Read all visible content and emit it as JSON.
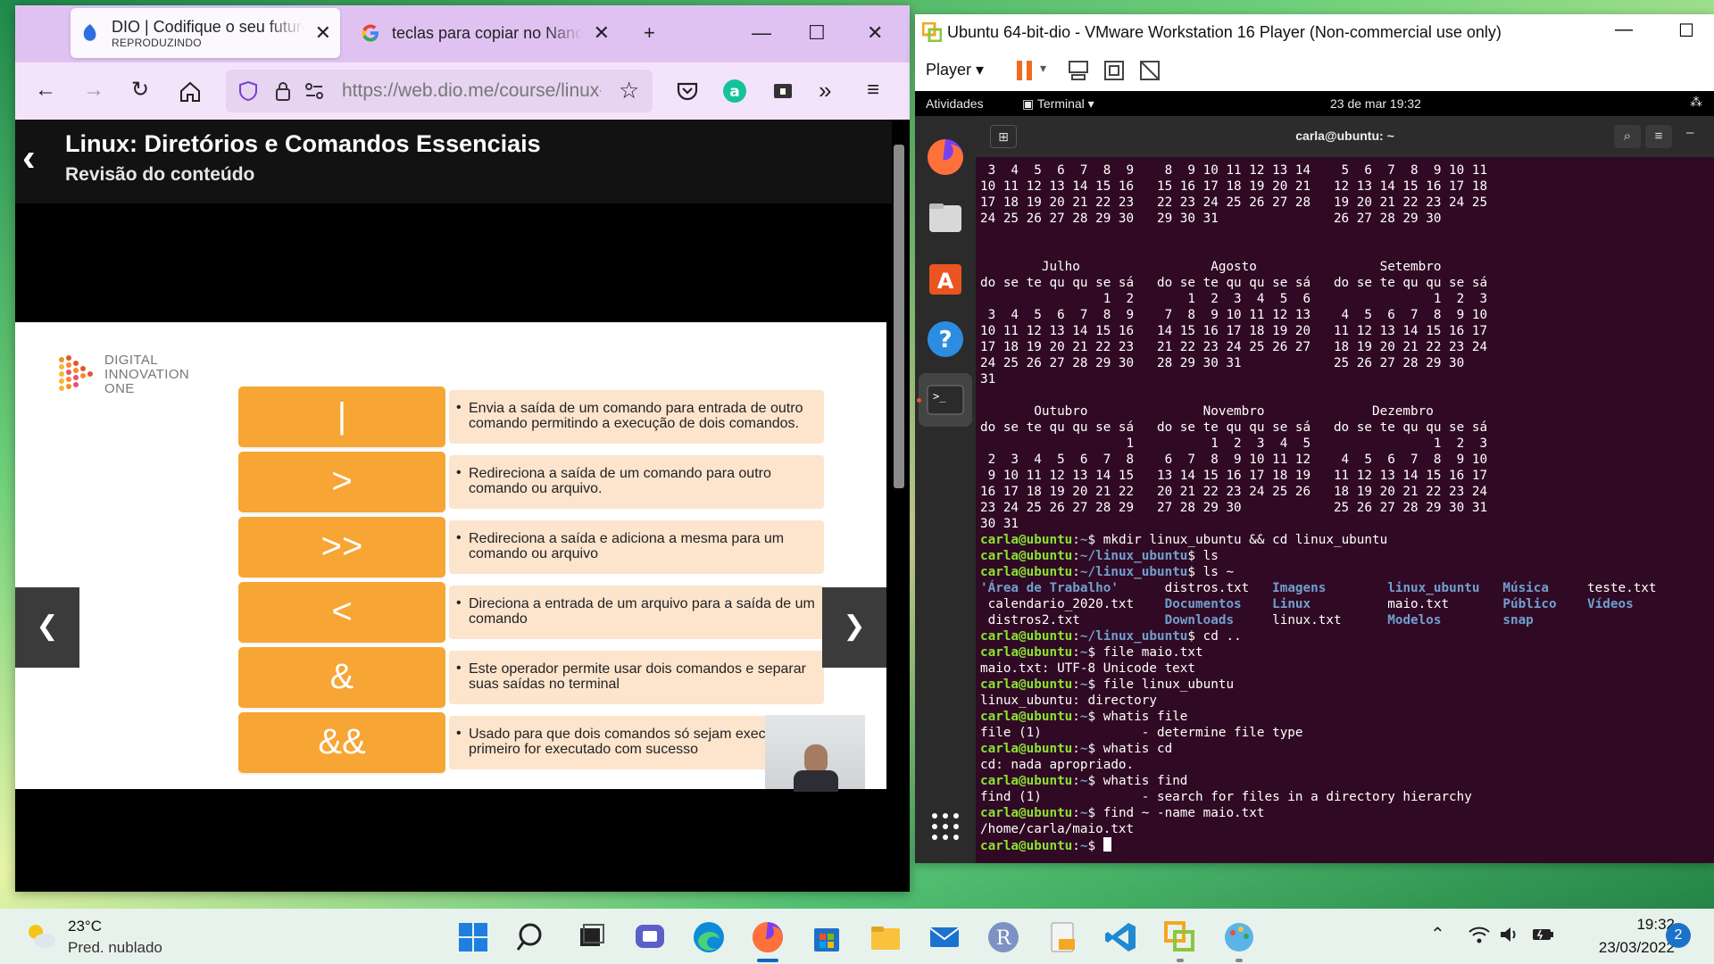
{
  "browser": {
    "tabs": [
      {
        "title": "DIO | Codifique o seu futuro",
        "subtitle": "REPRODUZINDO"
      },
      {
        "title": "teclas para copiar no Nano?"
      }
    ],
    "url": "https://web.dio.me/course/linux-diretorios",
    "course_title": "Linux: Diretórios e Comandos Essenciais",
    "course_subtitle": "Revisão do conteúdo",
    "slide": {
      "logo_text": "DIGITAL\nINNOVATION\nONE",
      "operators": [
        {
          "key": "|",
          "desc": "Envia a saída de um comando para entrada de outro comando permitindo a execução de dois comandos."
        },
        {
          "key": ">",
          "desc": "Redireciona a saída de um comando para outro comando ou arquivo."
        },
        {
          "key": ">>",
          "desc": "Redireciona a saída e adiciona a mesma para um comando ou arquivo"
        },
        {
          "key": "<",
          "desc": "Direciona a entrada de um arquivo para a saída de um comando"
        },
        {
          "key": "&",
          "desc": "Este operador permite usar dois comandos e separar suas saídas no terminal"
        },
        {
          "key": "&&",
          "desc": "Usado para que dois comandos só sejam exec se o primeiro for executado com sucesso"
        }
      ]
    }
  },
  "vmware": {
    "title": "Ubuntu 64-bit-dio - VMware Workstation 16 Player (Non-commercial use only)",
    "player_label": "Player",
    "gnome": {
      "activities": "Atividades",
      "app": "Terminal",
      "datetime": "23 de mar  19:32"
    },
    "terminal_title": "carla@ubuntu: ~",
    "terminal_lines": [
      " 3  4  5  6  7  8  9    8  9 10 11 12 13 14    5  6  7  8  9 10 11",
      "10 11 12 13 14 15 16   15 16 17 18 19 20 21   12 13 14 15 16 17 18",
      "17 18 19 20 21 22 23   22 23 24 25 26 27 28   19 20 21 22 23 24 25",
      "24 25 26 27 28 29 30   29 30 31               26 27 28 29 30",
      "",
      "",
      "        Julho                 Agosto                Setembro",
      "do se te qu qu se sá   do se te qu qu se sá   do se te qu qu se sá",
      "                1  2       1  2  3  4  5  6                1  2  3",
      " 3  4  5  6  7  8  9    7  8  9 10 11 12 13    4  5  6  7  8  9 10",
      "10 11 12 13 14 15 16   14 15 16 17 18 19 20   11 12 13 14 15 16 17",
      "17 18 19 20 21 22 23   21 22 23 24 25 26 27   18 19 20 21 22 23 24",
      "24 25 26 27 28 29 30   28 29 30 31            25 26 27 28 29 30",
      "31",
      "",
      "       Outubro               Novembro              Dezembro",
      "do se te qu qu se sá   do se te qu qu se sá   do se te qu qu se sá",
      "                   1          1  2  3  4  5                1  2  3",
      " 2  3  4  5  6  7  8    6  7  8  9 10 11 12    4  5  6  7  8  9 10",
      " 9 10 11 12 13 14 15   13 14 15 16 17 18 19   11 12 13 14 15 16 17",
      "16 17 18 19 20 21 22   20 21 22 23 24 25 26   18 19 20 21 22 23 24",
      "23 24 25 26 27 28 29   27 28 29 30            25 26 27 28 29 30 31",
      "30 31"
    ],
    "session": [
      {
        "prompt": "carla@ubuntu",
        "path": "~",
        "cmd": "mkdir linux_ubuntu && cd linux_ubuntu"
      },
      {
        "prompt": "carla@ubuntu",
        "path": "~/linux_ubuntu",
        "cmd": "ls"
      },
      {
        "prompt": "carla@ubuntu",
        "path": "~/linux_ubuntu",
        "cmd": "ls ~"
      },
      {
        "ls": [
          [
            {
              "t": "'Área de Trabalho'",
              "d": true
            },
            {
              "t": "distros.txt"
            },
            {
              "t": "Imagens",
              "d": true
            },
            {
              "t": "linux_ubuntu",
              "d": true
            },
            {
              "t": "Música",
              "d": true
            },
            {
              "t": "teste.txt"
            }
          ],
          [
            {
              "t": " calendario_2020.txt"
            },
            {
              "t": "Documentos",
              "d": true
            },
            {
              "t": "Linux",
              "d": true
            },
            {
              "t": "maio.txt"
            },
            {
              "t": "Público",
              "d": true
            },
            {
              "t": "Vídeos",
              "d": true
            }
          ],
          [
            {
              "t": " distros2.txt"
            },
            {
              "t": "Downloads",
              "d": true
            },
            {
              "t": "linux.txt"
            },
            {
              "t": "Modelos",
              "d": true
            },
            {
              "t": "snap",
              "d": true
            },
            {
              "t": ""
            }
          ]
        ]
      },
      {
        "prompt": "carla@ubuntu",
        "path": "~/linux_ubuntu",
        "cmd": "cd .."
      },
      {
        "prompt": "carla@ubuntu",
        "path": "~",
        "cmd": "file maio.txt"
      },
      {
        "out": "maio.txt: UTF-8 Unicode text"
      },
      {
        "prompt": "carla@ubuntu",
        "path": "~",
        "cmd": "file linux_ubuntu"
      },
      {
        "out": "linux_ubuntu: directory"
      },
      {
        "prompt": "carla@ubuntu",
        "path": "~",
        "cmd": "whatis file"
      },
      {
        "out": "file (1)             - determine file type"
      },
      {
        "prompt": "carla@ubuntu",
        "path": "~",
        "cmd": "whatis cd"
      },
      {
        "out": "cd: nada apropriado."
      },
      {
        "prompt": "carla@ubuntu",
        "path": "~",
        "cmd": "whatis find"
      },
      {
        "out": "find (1)             - search for files in a directory hierarchy"
      },
      {
        "prompt": "carla@ubuntu",
        "path": "~",
        "cmd": "find ~ -name maio.txt"
      },
      {
        "out": "/home/carla/maio.txt"
      },
      {
        "prompt": "carla@ubuntu",
        "path": "~",
        "cmd": "",
        "cursor": true
      }
    ]
  },
  "taskbar": {
    "weather_temp": "23°C",
    "weather_desc": "Pred. nublado",
    "time": "19:32",
    "date": "23/03/2022",
    "notifications": "2"
  }
}
